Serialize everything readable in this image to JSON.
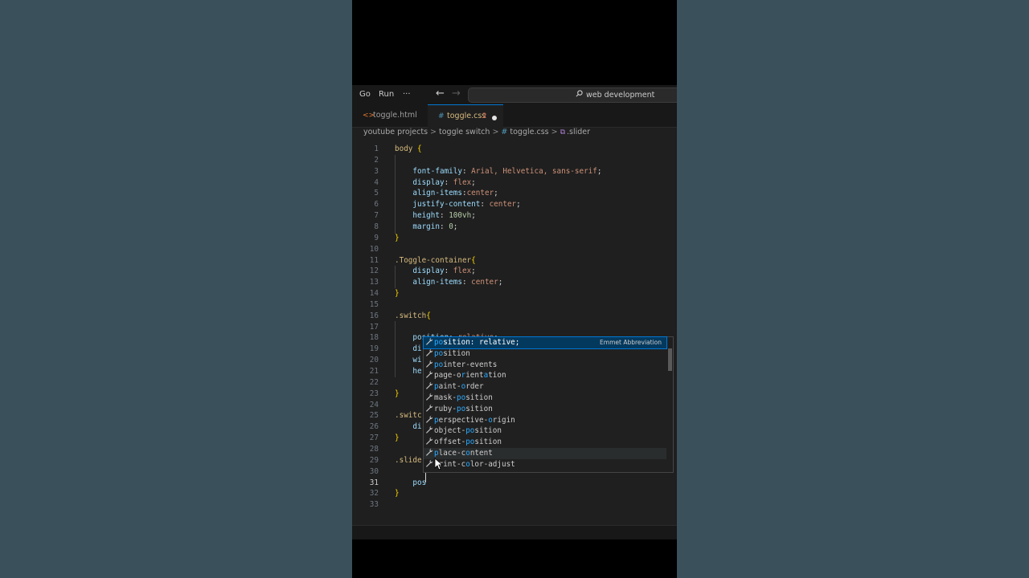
{
  "window": {
    "menu": [
      "Go",
      "Run"
    ],
    "more_label": "···",
    "back_icon": "←",
    "forward_icon": "→",
    "search_icon": "⌕",
    "search_text": "web development"
  },
  "tabs": [
    {
      "icon": "<>",
      "label": "toggle.html",
      "active": false
    },
    {
      "icon": "#",
      "label": "toggle.css",
      "problems": "2",
      "modified": true,
      "active": true
    }
  ],
  "breadcrumb": {
    "parts": [
      "youtube projects",
      "toggle switch",
      "toggle.css",
      ".slider"
    ],
    "separator": ">",
    "file_icon": "#",
    "symbol_icon": "⧉"
  },
  "editor": {
    "current_line": "31",
    "lines": [
      {
        "n": "1",
        "t": "body {"
      },
      {
        "n": "2",
        "t": ""
      },
      {
        "n": "3",
        "t": "    font-family: Arial, Helvetica, sans-serif;"
      },
      {
        "n": "4",
        "t": "    display: flex;"
      },
      {
        "n": "5",
        "t": "    align-items:center;"
      },
      {
        "n": "6",
        "t": "    justify-content: center;"
      },
      {
        "n": "7",
        "t": "    height: 100vh;"
      },
      {
        "n": "8",
        "t": "    margin: 0;"
      },
      {
        "n": "9",
        "t": "}"
      },
      {
        "n": "10",
        "t": ""
      },
      {
        "n": "11",
        "t": ".Toggle-container{"
      },
      {
        "n": "12",
        "t": "    display: flex;"
      },
      {
        "n": "13",
        "t": "    align-items: center;"
      },
      {
        "n": "14",
        "t": "}"
      },
      {
        "n": "15",
        "t": ""
      },
      {
        "n": "16",
        "t": ".switch{"
      },
      {
        "n": "17",
        "t": ""
      },
      {
        "n": "18",
        "t": "    position: relative;"
      },
      {
        "n": "19",
        "t": "    di"
      },
      {
        "n": "20",
        "t": "    wi"
      },
      {
        "n": "21",
        "t": "    he"
      },
      {
        "n": "22",
        "t": ""
      },
      {
        "n": "23",
        "t": "}"
      },
      {
        "n": "24",
        "t": ""
      },
      {
        "n": "25",
        "t": ".switc"
      },
      {
        "n": "26",
        "t": "    di"
      },
      {
        "n": "27",
        "t": "}"
      },
      {
        "n": "28",
        "t": ""
      },
      {
        "n": "29",
        "t": ".slide"
      },
      {
        "n": "30",
        "t": ""
      },
      {
        "n": "31",
        "t": "    pos"
      },
      {
        "n": "32",
        "t": "}"
      },
      {
        "n": "33",
        "t": ""
      }
    ]
  },
  "suggest": {
    "icon": "🔧",
    "items": [
      {
        "label": "position: relative;",
        "detail": "Emmet Abbreviation",
        "active": true
      },
      {
        "label": "position"
      },
      {
        "label": "pointer-events"
      },
      {
        "label": "page-orientation"
      },
      {
        "label": "paint-order"
      },
      {
        "label": "mask-position"
      },
      {
        "label": "ruby-position"
      },
      {
        "label": "perspective-origin"
      },
      {
        "label": "object-position"
      },
      {
        "label": "offset-position"
      },
      {
        "label": "place-content",
        "hover": true
      },
      {
        "label": "print-color-adjust"
      }
    ]
  },
  "colors": {
    "background": "#3a515b",
    "editor_bg": "#1f1f1f",
    "accent": "#0078d4"
  }
}
